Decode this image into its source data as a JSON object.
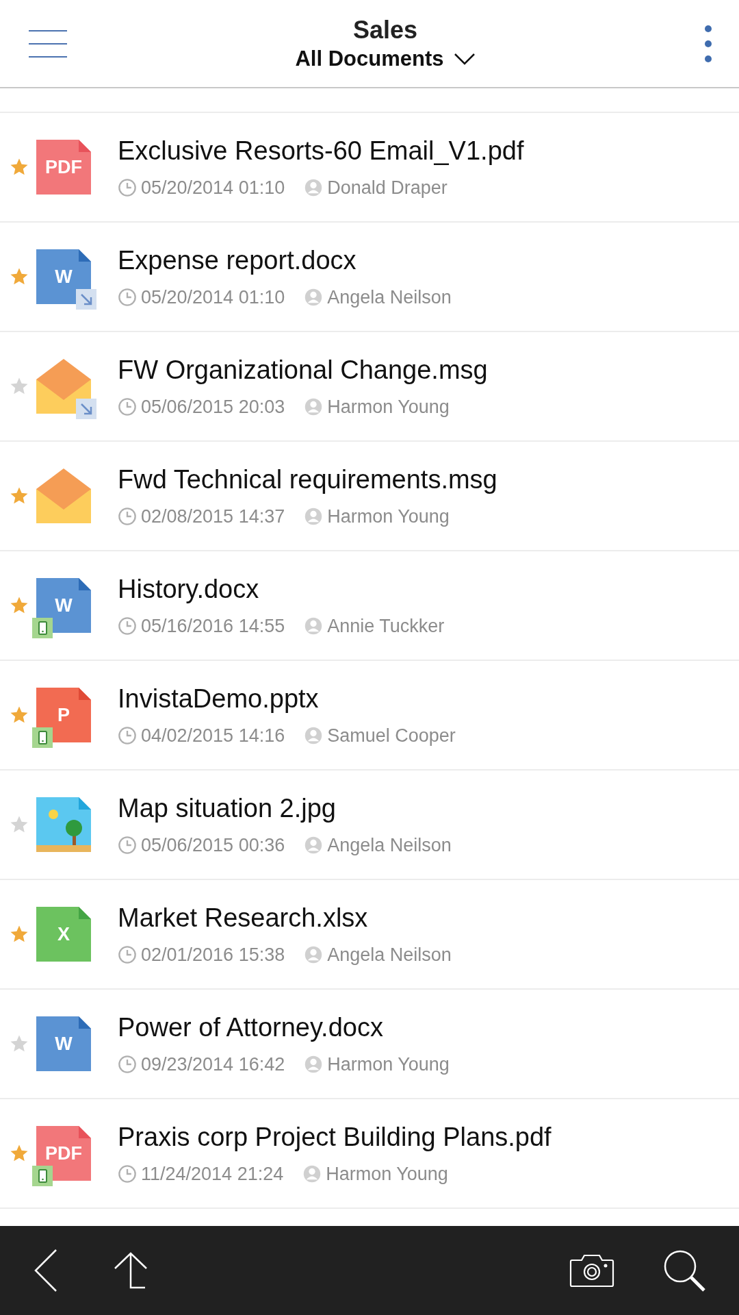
{
  "header": {
    "title": "Sales",
    "view": "All Documents"
  },
  "documents": [
    {
      "name": "Exclusive Resorts-60 Email_V1.pdf",
      "date": "05/20/2014 01:10",
      "author": "Donald Draper",
      "starred": true,
      "kind": "pdf",
      "type_label": "PDF",
      "shortcut": false,
      "on_device": false
    },
    {
      "name": "Expense report.docx",
      "date": "05/20/2014 01:10",
      "author": "Angela Neilson",
      "starred": true,
      "kind": "word",
      "type_label": "W",
      "shortcut": true,
      "on_device": false
    },
    {
      "name": "FW Organizational Change.msg",
      "date": "05/06/2015 20:03",
      "author": "Harmon Young",
      "starred": false,
      "kind": "mail",
      "shortcut": true,
      "on_device": false
    },
    {
      "name": "Fwd Technical requirements.msg",
      "date": "02/08/2015 14:37",
      "author": "Harmon Young",
      "starred": true,
      "kind": "mail",
      "shortcut": false,
      "on_device": false
    },
    {
      "name": "History.docx",
      "date": "05/16/2016 14:55",
      "author": "Annie Tuckker",
      "starred": true,
      "kind": "word",
      "type_label": "W",
      "shortcut": false,
      "on_device": true
    },
    {
      "name": "InvistaDemo.pptx",
      "date": "04/02/2015 14:16",
      "author": "Samuel Cooper",
      "starred": true,
      "kind": "powerpoint",
      "type_label": "P",
      "shortcut": false,
      "on_device": true
    },
    {
      "name": "Map situation 2.jpg",
      "date": "05/06/2015 00:36",
      "author": "Angela Neilson",
      "starred": false,
      "kind": "image",
      "shortcut": false,
      "on_device": false
    },
    {
      "name": "Market Research.xlsx",
      "date": "02/01/2016 15:38",
      "author": "Angela Neilson",
      "starred": true,
      "kind": "excel",
      "type_label": "X",
      "shortcut": false,
      "on_device": false
    },
    {
      "name": "Power of Attorney.docx",
      "date": "09/23/2014 16:42",
      "author": "Harmon Young",
      "starred": false,
      "kind": "word",
      "type_label": "W",
      "shortcut": false,
      "on_device": false
    },
    {
      "name": "Praxis corp Project Building Plans.pdf",
      "date": "11/24/2014 21:24",
      "author": "Harmon Young",
      "starred": true,
      "kind": "pdf",
      "type_label": "PDF",
      "shortcut": false,
      "on_device": true
    }
  ]
}
